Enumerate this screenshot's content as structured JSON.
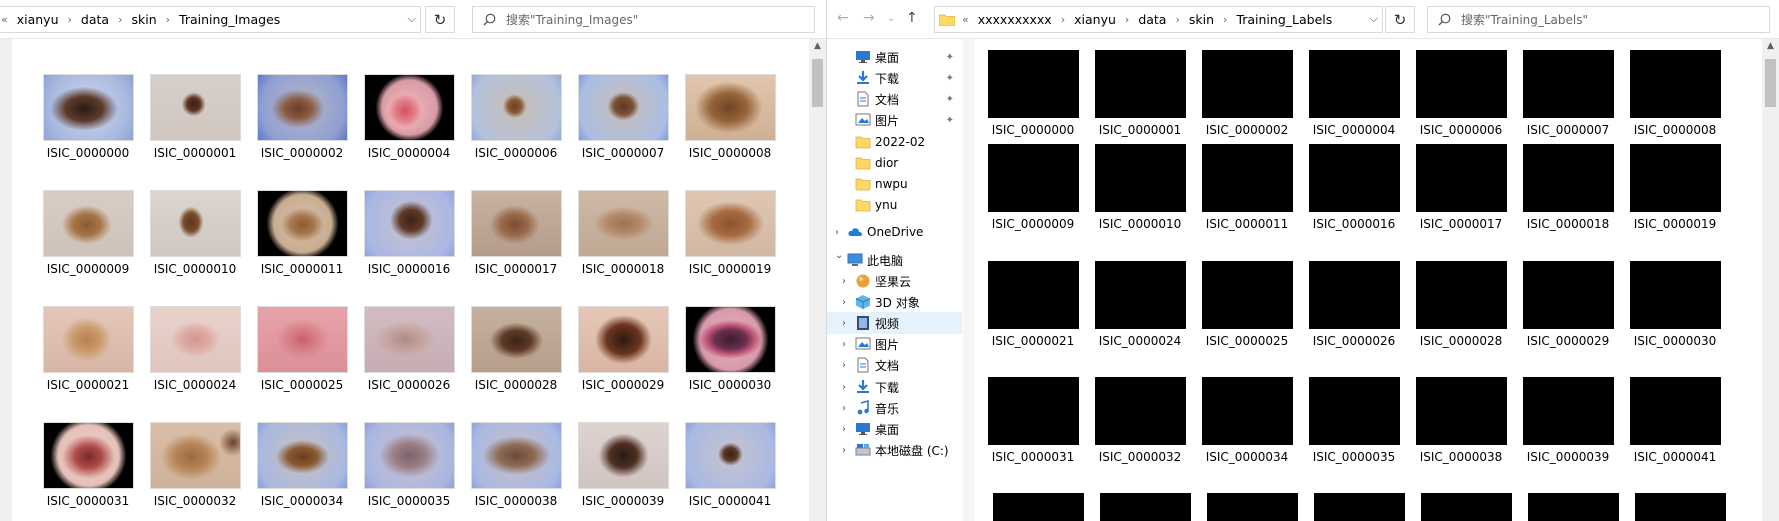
{
  "left": {
    "crumbs": [
      "xianyu",
      "data",
      "skin",
      "Training_Images"
    ],
    "search_placeholder": "搜索\"Training_Images\"",
    "files": [
      {
        "name": "ISIC_0000000",
        "bg": "radial-gradient(ellipse 38% 34% at 45% 52%, #2a1c16 0%, #5b3a2a 55%, rgba(0,0,0,0) 100%), radial-gradient(circle at 50% 50%, #cfd8ec 0%, #a9b9df 70%, #8fa4d6 100%)"
      },
      {
        "name": "ISIC_0000001",
        "bg": "radial-gradient(circle 12px at 48% 45%, #3a1f14 0%, #5c3422 55%, rgba(0,0,0,0) 100%), linear-gradient(#d7d0ca, #cfc6bf)"
      },
      {
        "name": "ISIC_0000002",
        "bg": "radial-gradient(ellipse 30% 30% at 45% 52%, #6a3f2a 0%, #8a5a40 50%, rgba(0,0,0,0) 100%), radial-gradient(circle at 50% 50%, #b8b7c8 0%, #8f9fd3 75%, #5f78c7 100%)"
      },
      {
        "name": "ISIC_0000004",
        "bg": "radial-gradient(circle 22px at 45% 55%, #d45060 0%, #e07e88 45%, #eaa9b0 75%, rgba(0,0,0,0) 100%), radial-gradient(circle 34px at 50% 50%, #e9b7bd 0%, #d99ca6 80%, #000 100%)"
      },
      {
        "name": "ISIC_0000006",
        "bg": "radial-gradient(circle 12px at 48% 48%, #6b3f24 0%, #8b5a36 55%, rgba(0,0,0,0) 100%), radial-gradient(circle at 50% 50%, #c9bfb4 0%, #b3c0dc 80%, #93a8d8 100%)"
      },
      {
        "name": "ISIC_0000007",
        "bg": "radial-gradient(ellipse 18% 22% at 50% 48%, #5d3a24 0%, #7b5234 60%, rgba(0,0,0,0) 100%), radial-gradient(circle at 50% 50%, #c9bfb4 0%, #a9bde6 80%, #7f9be0 100%)"
      },
      {
        "name": "ISIC_0000008",
        "bg": "radial-gradient(ellipse 38% 40% at 48% 50%, #6e4325 0%, #97653a 55%, rgba(0,0,0,0) 100%), linear-gradient(#e1c6ad, #cfb095)"
      },
      {
        "name": "ISIC_0000009",
        "bg": "radial-gradient(ellipse 28% 30% at 48% 52%, #8b5a32 0%, #a67547 55%, rgba(0,0,0,0) 100%), linear-gradient(#d8cdc4, #cfc2b8)"
      },
      {
        "name": "ISIC_0000010",
        "bg": "radial-gradient(ellipse 14% 24% at 45% 48%, #5a3620 0%, #7a4c2c 60%, rgba(0,0,0,0) 100%), linear-gradient(#dcd5cf, #cfc8c2)"
      },
      {
        "name": "ISIC_0000011",
        "bg": "radial-gradient(ellipse 24% 26% at 50% 52%, #8b5a36 0%, #a7774e 55%, rgba(0,0,0,0) 100%), radial-gradient(circle 36px at 50% 50%, #d7c0a6 0%, #c8ad92 80%, #000 100%)"
      },
      {
        "name": "ISIC_0000016",
        "bg": "radial-gradient(ellipse 24% 30% at 52% 45%, #3a2218 0%, #5e3a28 55%, rgba(0,0,0,0) 100%), radial-gradient(circle at 50% 50%, #c9c3d0 0%, #a9b7e4 80%, #8ea4e0 100%)"
      },
      {
        "name": "ISIC_0000017",
        "bg": "radial-gradient(ellipse 28% 30% at 48% 52%, #7a4c32 0%, #9a6a4a 55%, rgba(0,0,0,0) 100%), linear-gradient(#c8b2a2, #b59c8a)"
      },
      {
        "name": "ISIC_0000018",
        "bg": "radial-gradient(ellipse 34% 26% at 50% 50%, #9b7250 0%, #b3896a 55%, rgba(0,0,0,0) 100%), linear-gradient(#ceb9a6, #bfa994)"
      },
      {
        "name": "ISIC_0000019",
        "bg": "radial-gradient(ellipse 38% 34% at 50% 50%, #8a5330 0%, #a66b40 55%, rgba(0,0,0,0) 100%), linear-gradient(#dfc7b4, #d2b8a3)"
      },
      {
        "name": "ISIC_0000021",
        "bg": "radial-gradient(ellipse 28% 34% at 48% 50%, #b88052 0%, #c99a6d 55%, rgba(0,0,0,0) 100%), linear-gradient(#e4c7b9, #d7b6a6)"
      },
      {
        "name": "ISIC_0000024",
        "bg": "radial-gradient(ellipse 28% 28% at 50% 50%, #d1968e 0%, #ddaba3 55%, rgba(0,0,0,0) 100%), linear-gradient(#e8d3cc, #dfc5bd)"
      },
      {
        "name": "ISIC_0000025",
        "bg": "radial-gradient(ellipse 30% 32% at 50% 50%, #c9616b 0%, #d98189 55%, rgba(0,0,0,0) 100%), linear-gradient(#e7a3aa, #dc8f97)"
      },
      {
        "name": "ISIC_0000026",
        "bg": "radial-gradient(ellipse 34% 28% at 45% 50%, #b08a84 0%, #c4a39e 55%, rgba(0,0,0,0) 100%), linear-gradient(#d2bcc2, #c6adb4)"
      },
      {
        "name": "ISIC_0000028",
        "bg": "radial-gradient(ellipse 30% 28% at 50% 52%, #3b2418 0%, #5e3a26 55%, rgba(0,0,0,0) 100%), linear-gradient(#c6b09f, #b69e8b)"
      },
      {
        "name": "ISIC_0000029",
        "bg": "radial-gradient(ellipse 32% 38% at 50% 50%, #2e1810 0%, #6b3520 60%, rgba(0,0,0,0) 100%), linear-gradient(#e6c7b8, #d9b5a2)"
      },
      {
        "name": "ISIC_0000030",
        "bg": "radial-gradient(ellipse 36% 30% at 50% 50%, #3a1e30 0%, #6b2f4d 50%, #c05678 75%, rgba(0,0,0,0) 100%), radial-gradient(circle 38px at 50% 50%, #e8b3c0 0%, #d89aab 80%, #000 100%)"
      },
      {
        "name": "ISIC_0000031",
        "bg": "radial-gradient(ellipse 30% 34% at 50% 52%, #7a2a2a 0%, #b04a4a 50%, rgba(0,0,0,0) 100%), radial-gradient(circle 38px at 50% 50%, #efd6cf 0%, #e4c1b8 80%, #000 100%)"
      },
      {
        "name": "ISIC_0000032",
        "bg": "radial-gradient(ellipse 34% 36% at 45% 52%, #9a6a44 0%, #b68658 55%, rgba(0,0,0,0) 100%), radial-gradient(circle 14px at 92% 30%, #6b4028 0%, rgba(0,0,0,0) 100%), linear-gradient(#d9bfa7, #ceb198)"
      },
      {
        "name": "ISIC_0000034",
        "bg": "radial-gradient(ellipse 30% 26% at 50% 52%, #6a3d1e 0%, #8b5a32 55%, rgba(0,0,0,0) 100%), radial-gradient(circle at 50% 50%, #c9c2c0 0%, #a8b8e0 80%, #87a0dc 100%)"
      },
      {
        "name": "ISIC_0000035",
        "bg": "radial-gradient(ellipse 34% 34% at 50% 50%, #7d6068 0%, #9c8088 55%, rgba(0,0,0,0) 100%), radial-gradient(circle at 50% 50%, #cbc3cf 0%, #a9b6e0 80%, #8aa2dc 100%)"
      },
      {
        "name": "ISIC_0000038",
        "bg": "radial-gradient(ellipse 38% 30% at 50% 50%, #6a4a38 0%, #8f6c58 55%, rgba(0,0,0,0) 100%), radial-gradient(circle at 50% 50%, #c8c0c6 0%, #a9b9e4 80%, #8aa3e0 100%)"
      },
      {
        "name": "ISIC_0000039",
        "bg": "radial-gradient(ellipse 28% 34% at 50% 50%, #2a1a12 0%, #4e3020 55%, rgba(0,0,0,0) 100%), linear-gradient(#ddd3d0, #cfc4c1)"
      },
      {
        "name": "ISIC_0000041",
        "bg": "radial-gradient(ellipse 14% 18% at 50% 48%, #3a2218 0%, #5b3826 55%, rgba(0,0,0,0) 100%), radial-gradient(circle at 50% 50%, #c7c4cf 0%, #a9b9e2 80%, #8ca4dc 100%)"
      }
    ]
  },
  "right": {
    "crumbs": [
      "xxxxxxxxxx",
      "xianyu",
      "data",
      "skin",
      "Training_Labels"
    ],
    "search_placeholder": "搜索\"Training_Labels\"",
    "nav": [
      {
        "label": "桌面",
        "icon": "desktop-icon",
        "pinned": true,
        "expandable": false,
        "level": 0
      },
      {
        "label": "下载",
        "icon": "download-icon",
        "pinned": true,
        "expandable": false,
        "level": 0
      },
      {
        "label": "文档",
        "icon": "document-icon",
        "pinned": true,
        "expandable": false,
        "level": 0
      },
      {
        "label": "图片",
        "icon": "picture-icon",
        "pinned": true,
        "expandable": false,
        "level": 0
      },
      {
        "label": "2022-02",
        "icon": "folder-icon",
        "pinned": false,
        "expandable": false,
        "level": 0
      },
      {
        "label": "dior",
        "icon": "folder-icon",
        "pinned": false,
        "expandable": false,
        "level": 0
      },
      {
        "label": "nwpu",
        "icon": "folder-icon",
        "pinned": false,
        "expandable": false,
        "level": 0
      },
      {
        "label": "ynu",
        "icon": "folder-icon",
        "pinned": false,
        "expandable": false,
        "level": 0
      },
      {
        "label": "OneDrive",
        "icon": "cloud-icon",
        "pinned": false,
        "expandable": "collapsed",
        "level": -1
      },
      {
        "label": "此电脑",
        "icon": "computer-icon",
        "pinned": false,
        "expandable": "expanded",
        "level": -1
      },
      {
        "label": "坚果云",
        "icon": "nut-cloud-icon",
        "pinned": false,
        "expandable": "collapsed",
        "level": 0
      },
      {
        "label": "3D 对象",
        "icon": "cube-icon",
        "pinned": false,
        "expandable": "collapsed",
        "level": 0
      },
      {
        "label": "视频",
        "icon": "video-icon",
        "pinned": false,
        "expandable": "collapsed",
        "level": 0,
        "selected": true
      },
      {
        "label": "图片",
        "icon": "picture-icon",
        "pinned": false,
        "expandable": "collapsed",
        "level": 0
      },
      {
        "label": "文档",
        "icon": "document-icon",
        "pinned": false,
        "expandable": "collapsed",
        "level": 0
      },
      {
        "label": "下载",
        "icon": "download-icon",
        "pinned": false,
        "expandable": "collapsed",
        "level": 0
      },
      {
        "label": "音乐",
        "icon": "music-icon",
        "pinned": false,
        "expandable": "collapsed",
        "level": 0
      },
      {
        "label": "桌面",
        "icon": "desktop-icon",
        "pinned": false,
        "expandable": "collapsed",
        "level": 0
      },
      {
        "label": "本地磁盘 (C:)",
        "icon": "drive-icon",
        "pinned": false,
        "expandable": "collapsed",
        "level": 0
      }
    ],
    "files": [
      "ISIC_0000000",
      "ISIC_0000001",
      "ISIC_0000002",
      "ISIC_0000004",
      "ISIC_0000006",
      "ISIC_0000007",
      "ISIC_0000008",
      "ISIC_0000009",
      "ISIC_0000010",
      "ISIC_0000011",
      "ISIC_0000016",
      "ISIC_0000017",
      "ISIC_0000018",
      "ISIC_0000019",
      "ISIC_0000021",
      "ISIC_0000024",
      "ISIC_0000025",
      "ISIC_0000026",
      "ISIC_0000028",
      "ISIC_0000029",
      "ISIC_0000030",
      "ISIC_0000031",
      "ISIC_0000032",
      "ISIC_0000034",
      "ISIC_0000035",
      "ISIC_0000038",
      "ISIC_0000039",
      "ISIC_0000041"
    ]
  },
  "colors": {
    "accent": "#0078d7",
    "selected_bg": "#e5f1fb",
    "folder": "#ffd767"
  }
}
